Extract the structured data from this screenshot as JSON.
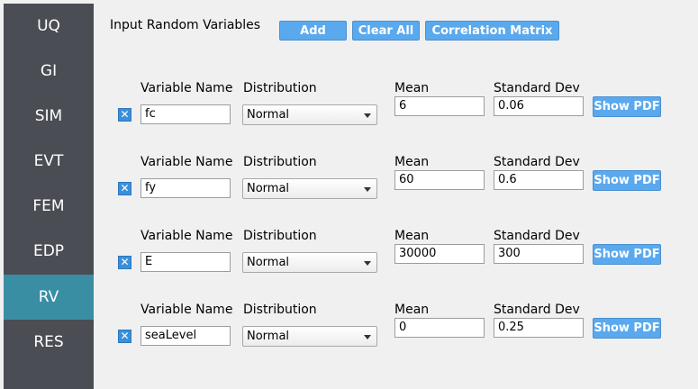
{
  "sidebar": {
    "items": [
      {
        "label": "UQ",
        "active": false
      },
      {
        "label": "GI",
        "active": false
      },
      {
        "label": "SIM",
        "active": false
      },
      {
        "label": "EVT",
        "active": false
      },
      {
        "label": "FEM",
        "active": false
      },
      {
        "label": "EDP",
        "active": false
      },
      {
        "label": "RV",
        "active": true
      },
      {
        "label": "RES",
        "active": false
      }
    ]
  },
  "header": {
    "title": "Input Random Variables",
    "add_label": "Add",
    "clear_label": "Clear All",
    "corr_label": "Correlation Matrix"
  },
  "labels": {
    "variable_name": "Variable Name",
    "distribution": "Distribution",
    "mean": "Mean",
    "std": "Standard Dev",
    "show_pdf": "Show PDF",
    "remove_glyph": "✕"
  },
  "variables": [
    {
      "name": "fc",
      "distribution": "Normal",
      "mean": "6",
      "std": "0.06"
    },
    {
      "name": "fy",
      "distribution": "Normal",
      "mean": "60",
      "std": "0.6"
    },
    {
      "name": "E",
      "distribution": "Normal",
      "mean": "30000",
      "std": "300"
    },
    {
      "name": "seaLevel",
      "distribution": "Normal",
      "mean": "0",
      "std": "0.25"
    }
  ],
  "colors": {
    "accent": "#5aa9ee",
    "sidebar": "#4a4d54",
    "sidebar_active": "#3a8ea4"
  }
}
